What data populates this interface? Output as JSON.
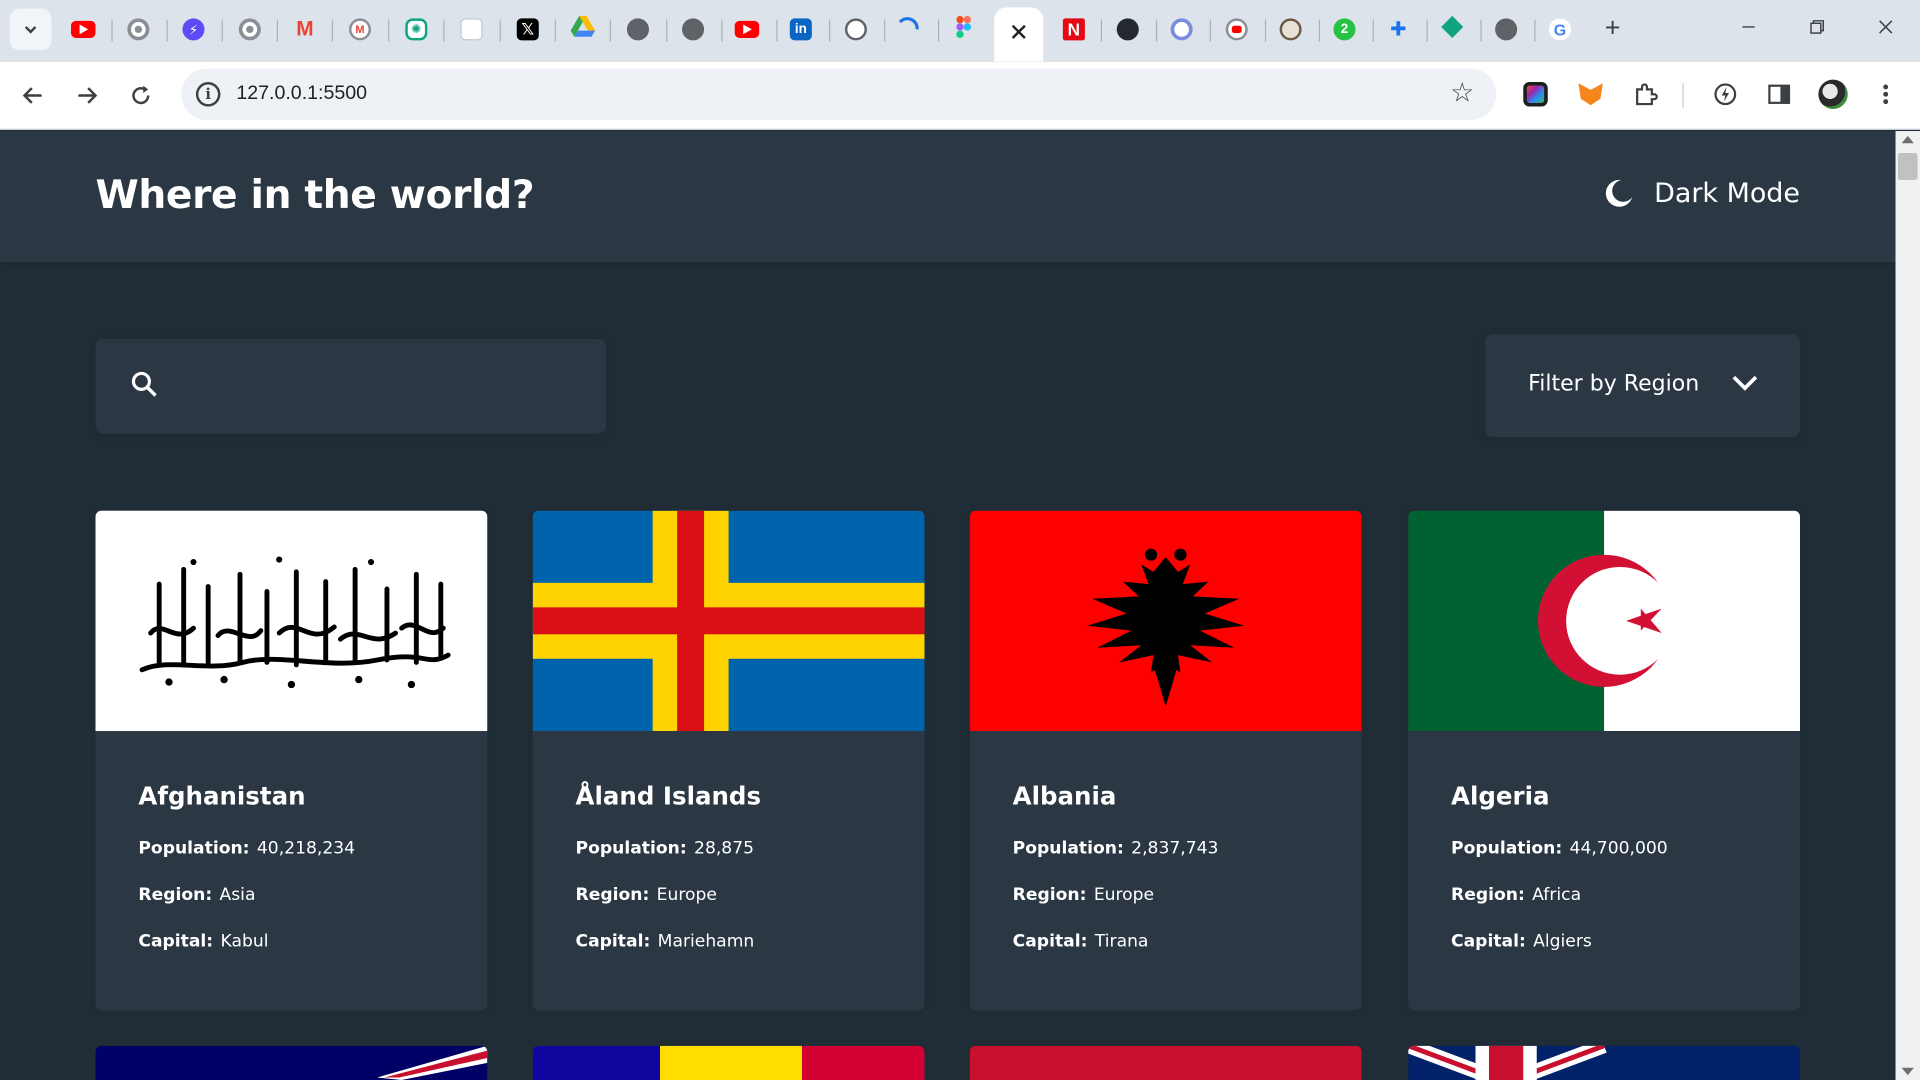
{
  "browser": {
    "tabs": [
      {
        "icon": "youtube-icon"
      },
      {
        "icon": "chrome-icon"
      },
      {
        "icon": "messenger-icon"
      },
      {
        "icon": "chrome-icon"
      },
      {
        "icon": "gmail-icon"
      },
      {
        "icon": "gmail-icon"
      },
      {
        "icon": "chatgpt-icon"
      },
      {
        "icon": "document-icon"
      },
      {
        "icon": "x-icon"
      },
      {
        "icon": "google-drive-icon"
      },
      {
        "icon": "globe-icon"
      },
      {
        "icon": "globe-icon"
      },
      {
        "icon": "youtube-icon"
      },
      {
        "icon": "linkedin-icon"
      },
      {
        "icon": "github-icon"
      },
      {
        "icon": "loading-icon"
      },
      {
        "icon": "figma-icon"
      },
      {
        "icon": "close-icon",
        "active": true
      },
      {
        "icon": "netflix-icon"
      },
      {
        "icon": "github-icon"
      },
      {
        "icon": "chrome-icon"
      },
      {
        "icon": "youtube-icon"
      },
      {
        "icon": "seal-icon"
      },
      {
        "icon": "badge-2-icon"
      },
      {
        "icon": "puzzle-icon"
      },
      {
        "icon": "diamond-icon"
      },
      {
        "icon": "globe-icon"
      },
      {
        "icon": "google-icon"
      }
    ],
    "url": "127.0.0.1:5500"
  },
  "header": {
    "title": "Where in the world?",
    "mode_label": "Dark Mode"
  },
  "controls": {
    "search_placeholder": "",
    "filter_label": "Filter by Region"
  },
  "labels": {
    "population": "Population:",
    "region": "Region:",
    "capital": "Capital:"
  },
  "countries": [
    {
      "name": "Afghanistan",
      "population": "40,218,234",
      "region": "Asia",
      "capital": "Kabul",
      "flag": "afghanistan-flag"
    },
    {
      "name": "Åland Islands",
      "population": "28,875",
      "region": "Europe",
      "capital": "Mariehamn",
      "flag": "aland-flag"
    },
    {
      "name": "Albania",
      "population": "2,837,743",
      "region": "Europe",
      "capital": "Tirana",
      "flag": "albania-flag"
    },
    {
      "name": "Algeria",
      "population": "44,700,000",
      "region": "Africa",
      "capital": "Algiers",
      "flag": "algeria-flag"
    }
  ],
  "theme": {
    "background": "#202c36",
    "element": "#2b3844",
    "text": "#ffffff"
  }
}
